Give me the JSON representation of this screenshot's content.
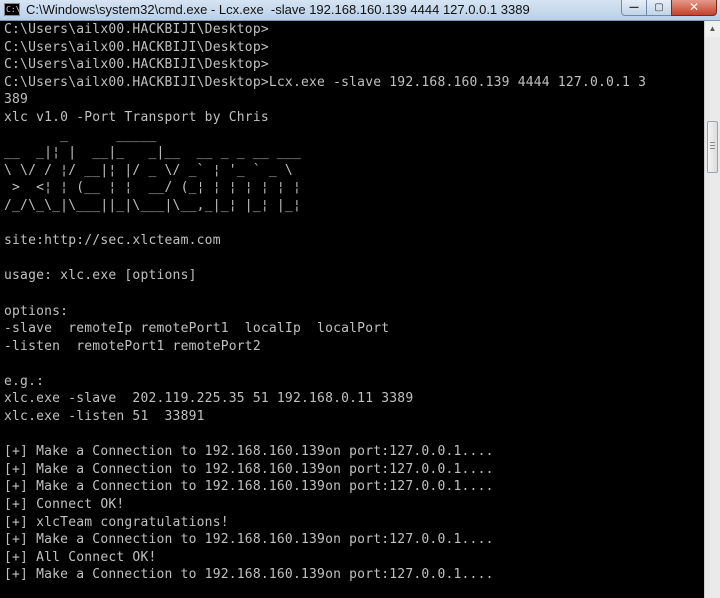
{
  "window": {
    "title": "C:\\Windows\\system32\\cmd.exe - Lcx.exe  -slave 192.168.160.139 4444 127.0.0.1 3389",
    "icon_text": "C:\\",
    "controls": {
      "minimize_icon": "minimize-icon",
      "maximize_icon": "maximize-icon",
      "close_icon": "close-icon",
      "minimize_glyph": "—",
      "maximize_glyph": "▢",
      "close_glyph": "✕"
    }
  },
  "console": {
    "lines": [
      "C:\\Users\\ailx00.HACKBIJI\\Desktop>",
      "C:\\Users\\ailx00.HACKBIJI\\Desktop>",
      "C:\\Users\\ailx00.HACKBIJI\\Desktop>",
      "C:\\Users\\ailx00.HACKBIJI\\Desktop>Lcx.exe -slave 192.168.160.139 4444 127.0.0.1 3",
      "389",
      "xlc v1.0 -Port Transport by Chris",
      "       _      _____",
      "__  _|¦ |  __|_   _|__  __ _ _ __ ___",
      "\\ \\/ / ¦/ __|¦ |/ _ \\/ _` ¦ '_ ` _ \\",
      " >  <¦ ¦ (__ ¦ ¦  __/ (_¦ ¦ ¦ ¦ ¦ ¦ ¦",
      "/_/\\_\\_|\\___||_|\\___|\\__,_|_¦ |_¦ |_¦",
      "",
      "site:http://sec.xlcteam.com",
      "",
      "usage: xlc.exe [options]",
      "",
      "options:",
      "-slave  remoteIp remotePort1  localIp  localPort",
      "-listen  remotePort1 remotePort2",
      "",
      "e.g.:",
      "xlc.exe -slave  202.119.225.35 51 192.168.0.11 3389",
      "xlc.exe -listen 51  33891",
      "",
      "[+] Make a Connection to 192.168.160.139on port:127.0.0.1....",
      "[+] Make a Connection to 192.168.160.139on port:127.0.0.1....",
      "[+] Make a Connection to 192.168.160.139on port:127.0.0.1....",
      "[+] Connect OK!",
      "[+] xlcTeam congratulations!",
      "[+] Make a Connection to 192.168.160.139on port:127.0.0.1....",
      "[+] All Connect OK!",
      "[+] Make a Connection to 192.168.160.139on port:127.0.0.1...."
    ]
  },
  "scrollbar": {
    "up_arrow_icon": "scroll-up-arrow-icon",
    "up_glyph": "▲"
  }
}
